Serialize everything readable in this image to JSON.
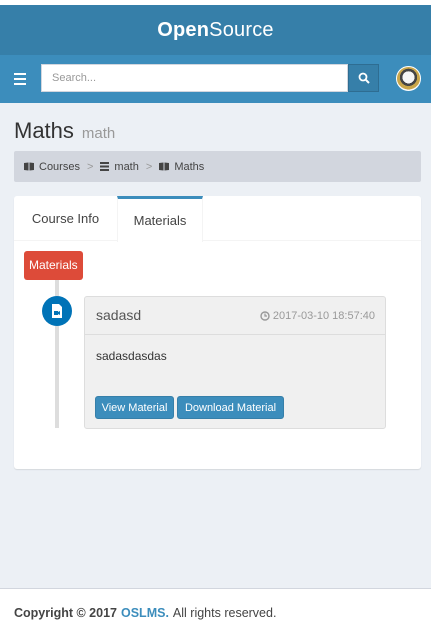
{
  "header": {
    "logo_bold": "Open",
    "logo_light": "Source",
    "search_placeholder": "Search..."
  },
  "page": {
    "title": "Maths",
    "subtitle": "math"
  },
  "breadcrumb": [
    {
      "label": "Courses",
      "icon": "book-icon"
    },
    {
      "label": "math",
      "icon": "list-icon"
    },
    {
      "label": "Maths",
      "icon": "book-icon"
    }
  ],
  "tabs": [
    {
      "label": "Course Info",
      "active": false
    },
    {
      "label": "Materials",
      "active": true
    }
  ],
  "timeline": {
    "label": "Materials",
    "item": {
      "title": "sadasd",
      "timestamp": "2017-03-10 18:57:40",
      "body": "sadasdasdas",
      "view_label": "View Material",
      "download_label": "Download Material"
    }
  },
  "footer": {
    "copyright": "Copyright © 2017",
    "brand": "OSLMS.",
    "rights": "All rights reserved."
  },
  "colors": {
    "header_dark": "#367fa9",
    "header": "#3c8dbc",
    "label_red": "#dd4b39",
    "icon_blue": "#0073b7"
  }
}
